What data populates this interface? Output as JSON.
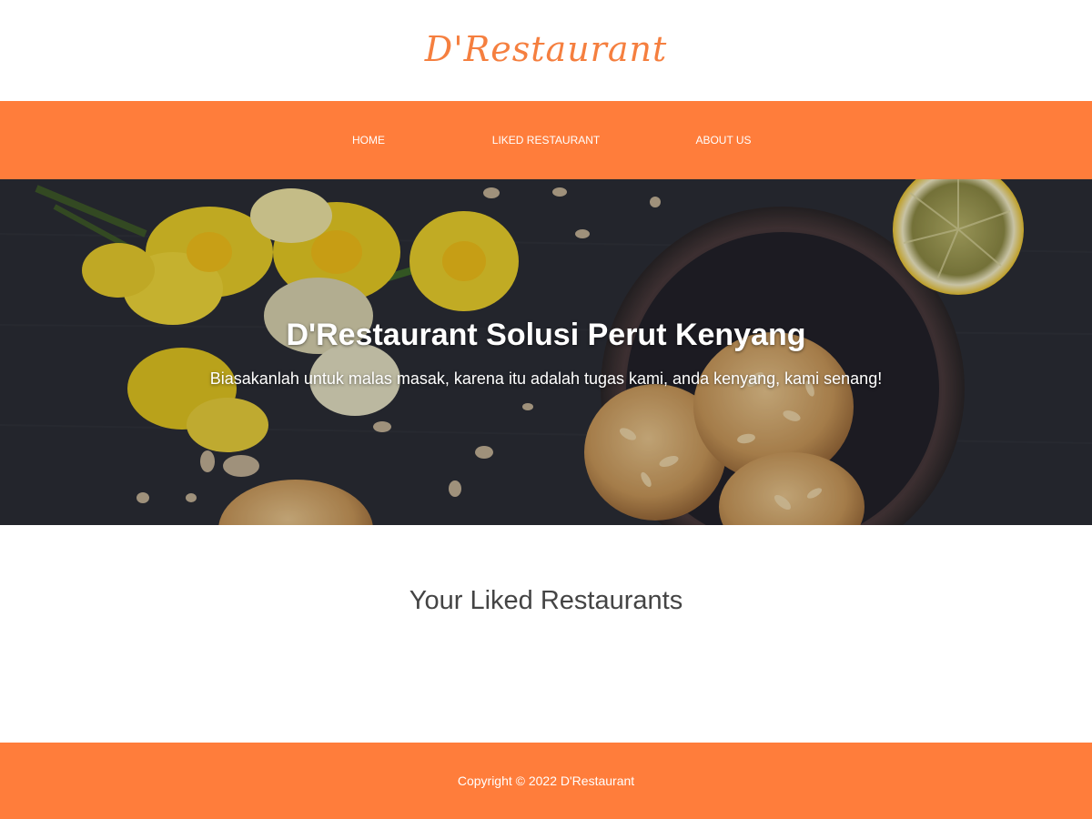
{
  "header": {
    "logo_text": "D'Restaurant"
  },
  "nav": {
    "items": [
      {
        "label": "HOME"
      },
      {
        "label": "LIKED RESTAURANT"
      },
      {
        "label": "ABOUT US"
      }
    ]
  },
  "hero": {
    "title": "D'Restaurant Solusi Perut Kenyang",
    "subtitle": "Biasakanlah untuk malas masak, karena itu adalah tugas kami, anda kenyang, kami senang!"
  },
  "main": {
    "section_title": "Your Liked Restaurants"
  },
  "footer": {
    "copyright": "Copyright © 2022 D'Restaurant"
  },
  "colors": {
    "accent": "#ff7d3b",
    "logo": "#f57f3f",
    "text": "#444444"
  }
}
